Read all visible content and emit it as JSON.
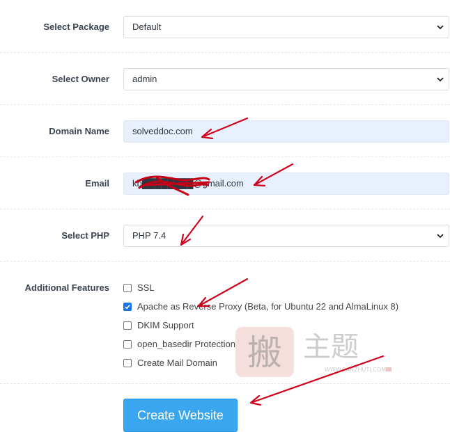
{
  "form": {
    "package": {
      "label": "Select Package",
      "value": "Default"
    },
    "owner": {
      "label": "Select Owner",
      "value": "admin"
    },
    "domain": {
      "label": "Domain Name",
      "value": "solveddoc.com"
    },
    "email": {
      "label": "Email",
      "value": "kb████████@gmail.com"
    },
    "php": {
      "label": "Select PHP",
      "value": "PHP 7.4"
    },
    "features": {
      "label": "Additional Features",
      "items": [
        {
          "label": "SSL",
          "checked": false
        },
        {
          "label": "Apache as Reverse Proxy (Beta, for Ubuntu 22 and AlmaLinux 8)",
          "checked": true
        },
        {
          "label": "DKIM Support",
          "checked": false
        },
        {
          "label": "open_basedir Protection",
          "checked": false
        },
        {
          "label": "Create Mail Domain",
          "checked": false
        }
      ]
    },
    "submit_label": "Create Website"
  },
  "watermark": {
    "text": "搬主题",
    "url": "WWW.BANZHUTI.COM"
  },
  "colors": {
    "accent": "#3aa6f0",
    "checkbox_checked": "#1a73e8",
    "annotation": "#d0021b",
    "autofill": "#e8f0fe"
  },
  "icons": {
    "select_arrow": "chevron-down-icon",
    "check": "check-icon"
  }
}
